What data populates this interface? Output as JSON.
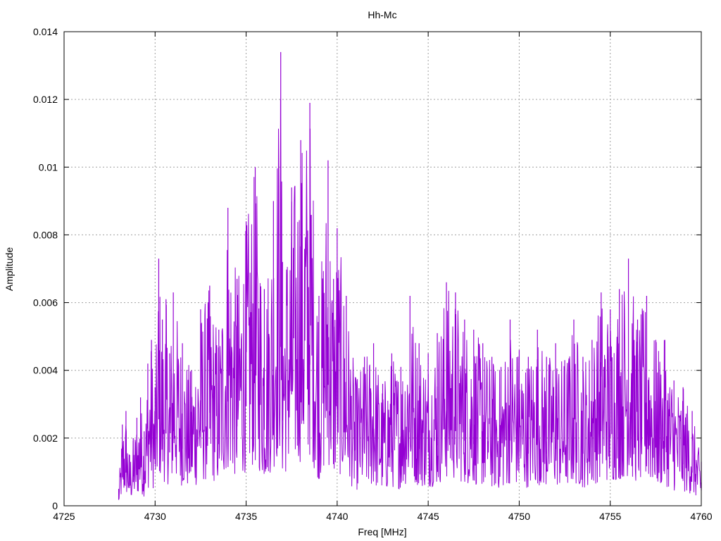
{
  "chart_data": {
    "type": "line",
    "title": "Hh-Mc",
    "xlabel": "Freq [MHz]",
    "ylabel": "Amplitude",
    "xlim": [
      4725,
      4760
    ],
    "ylim": [
      0,
      0.014
    ],
    "x_ticks": [
      "4725",
      "4730",
      "4735",
      "4740",
      "4745",
      "4750",
      "4755",
      "4760"
    ],
    "y_ticks": [
      "0",
      "0.002",
      "0.004",
      "0.006",
      "0.008",
      "0.01",
      "0.012",
      "0.014"
    ],
    "grid": true,
    "series": [
      {
        "color": "#9400d3",
        "x": [
          4728.0,
          4728.2,
          4728.4,
          4728.6,
          4728.8,
          4729.0,
          4729.2,
          4729.4,
          4729.6,
          4729.8,
          4730.0,
          4730.2,
          4730.4,
          4730.6,
          4730.8,
          4731.0,
          4731.5,
          4732.0,
          4732.5,
          4733.0,
          4733.5,
          4734.0,
          4734.5,
          4735.0,
          4735.5,
          4736.0,
          4736.5,
          4736.9,
          4737.0,
          4737.5,
          4738.0,
          4738.5,
          4739.0,
          4739.5,
          4739.8,
          4740.0,
          4740.5,
          4741.0,
          4741.5,
          4742.0,
          4742.5,
          4743.0,
          4743.5,
          4744.0,
          4744.5,
          4745.0,
          4745.5,
          4746.0,
          4746.5,
          4747.0,
          4747.5,
          4748.0,
          4748.5,
          4749.0,
          4749.5,
          4750.0,
          4750.5,
          4751.0,
          4751.5,
          4752.0,
          4752.5,
          4753.0,
          4753.5,
          4754.0,
          4754.5,
          4755.0,
          4755.5,
          4756.0,
          4756.5,
          4757.0,
          4757.5,
          4758.0,
          4758.5,
          4759.0,
          4759.5,
          4760.0
        ],
        "y": [
          0.0005,
          0.0024,
          0.0028,
          0.0015,
          0.002,
          0.0026,
          0.0032,
          0.0022,
          0.0042,
          0.0049,
          0.0035,
          0.0073,
          0.0055,
          0.0061,
          0.0045,
          0.0063,
          0.0048,
          0.004,
          0.0058,
          0.0065,
          0.0052,
          0.0088,
          0.0067,
          0.0084,
          0.01,
          0.0064,
          0.009,
          0.0134,
          0.0072,
          0.0094,
          0.0108,
          0.0119,
          0.0062,
          0.0102,
          0.0067,
          0.0082,
          0.0062,
          0.0038,
          0.0044,
          0.0048,
          0.0036,
          0.0045,
          0.0041,
          0.0062,
          0.0048,
          0.0045,
          0.0051,
          0.0066,
          0.0063,
          0.0055,
          0.0052,
          0.0048,
          0.0044,
          0.0041,
          0.0055,
          0.0046,
          0.0044,
          0.0052,
          0.0044,
          0.0048,
          0.0043,
          0.0055,
          0.0044,
          0.0049,
          0.0063,
          0.0058,
          0.0064,
          0.0073,
          0.0055,
          0.0062,
          0.0049,
          0.0049,
          0.0037,
          0.0035,
          0.0028,
          0.0013
        ]
      }
    ]
  }
}
